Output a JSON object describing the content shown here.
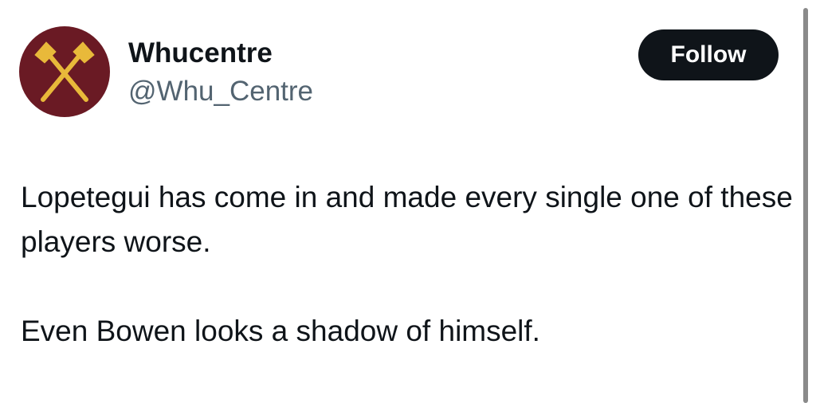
{
  "author": {
    "display_name": "Whucentre",
    "handle": "@Whu_Centre",
    "avatar_icon": "crossed-hammers-icon",
    "avatar_colors": {
      "background": "#6a1a24",
      "hammers": "#e8b93a"
    }
  },
  "actions": {
    "follow_label": "Follow"
  },
  "tweet": {
    "paragraphs": [
      "Lopetegui has come in and made every single one of these players worse.",
      "Even Bowen looks a shadow of himself."
    ]
  },
  "colors": {
    "text_primary": "#0f1419",
    "text_secondary": "#536471",
    "button_bg": "#0f1419",
    "button_text": "#ffffff"
  }
}
